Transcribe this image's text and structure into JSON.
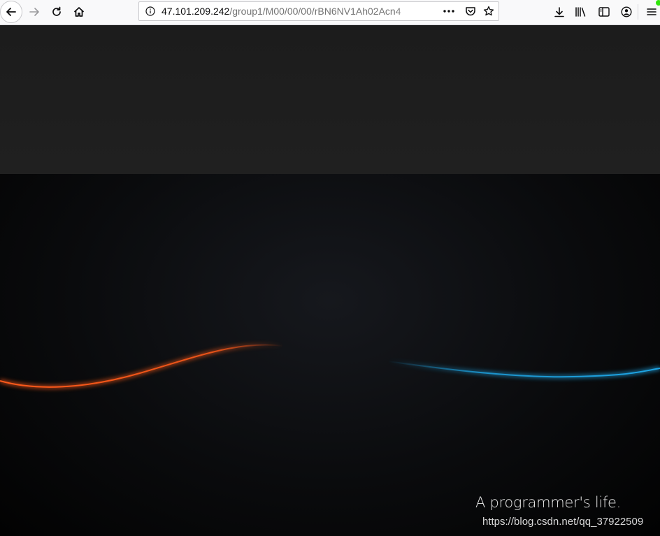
{
  "browser": {
    "url_host": "47.101.209.242",
    "url_path": "/group1/M00/00/00/rBN6NV1Ah02Acn4",
    "icons": {
      "back": "back-arrow-icon",
      "forward": "forward-arrow-icon",
      "reload": "reload-icon",
      "home": "home-icon",
      "site_info": "info-icon",
      "page_actions": "ellipsis-icon",
      "pocket": "pocket-icon",
      "bookmark": "star-icon",
      "downloads": "download-icon",
      "library": "library-icon",
      "sidebar": "sidebar-icon",
      "account": "account-icon",
      "menu": "hamburger-menu-icon"
    },
    "badge_color": "#30e60b"
  },
  "image": {
    "tagline": "A programmer's life.",
    "watermark": "https://blog.csdn.net/qq_37922509",
    "wave_left_color": "#ff5a1a",
    "wave_right_color": "#1ea6e6"
  }
}
